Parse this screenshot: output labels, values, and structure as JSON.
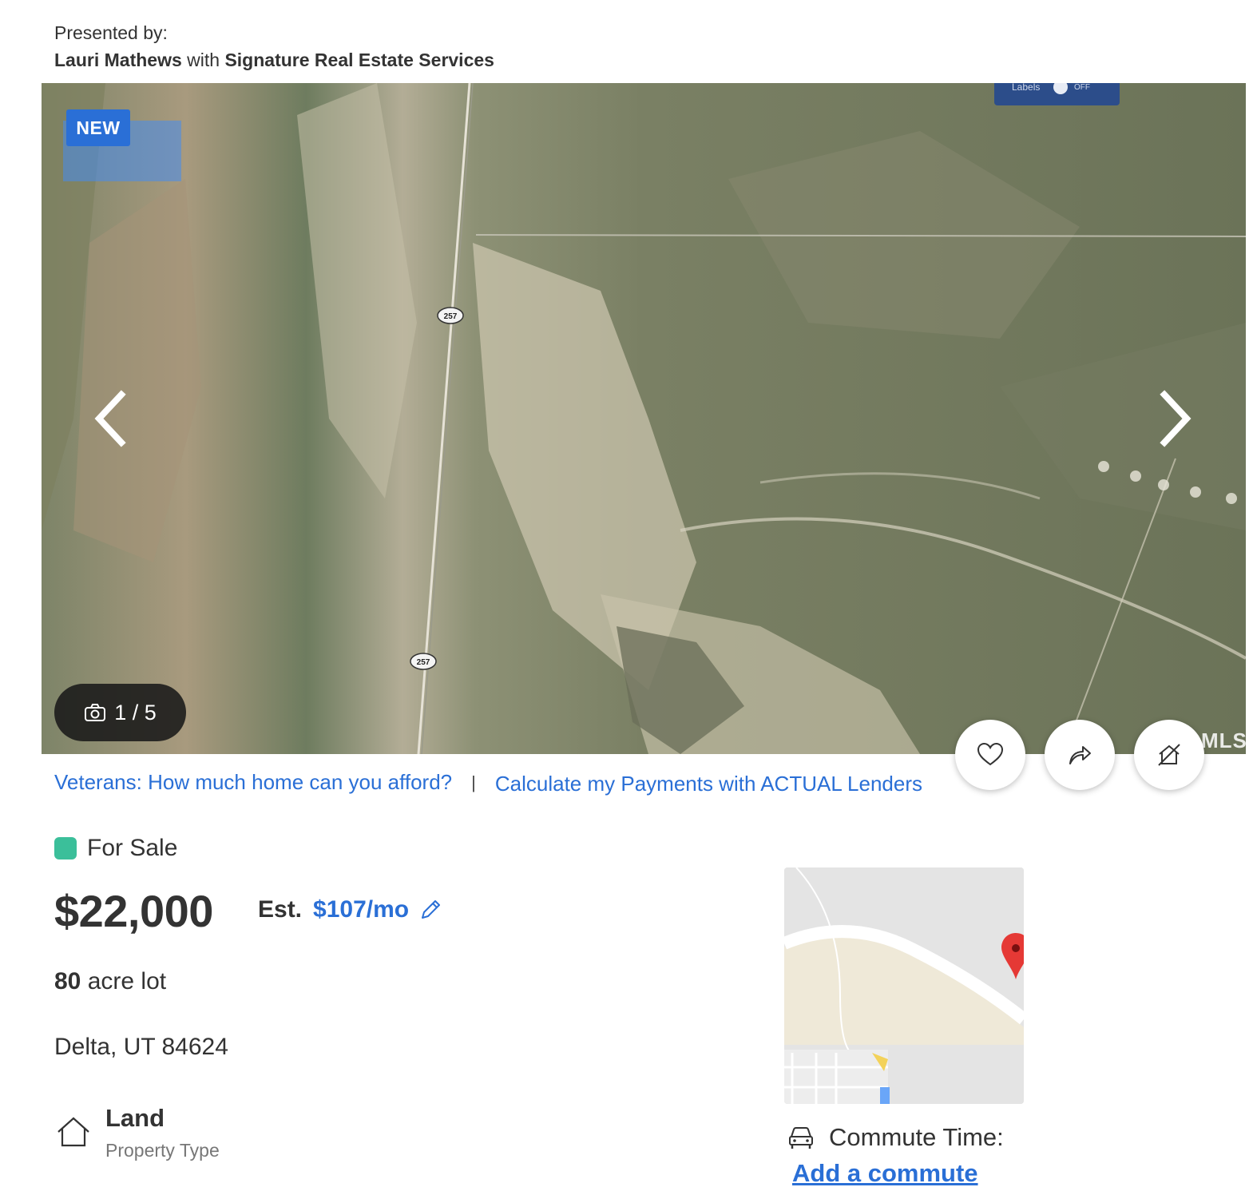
{
  "presented": {
    "label": "Presented by:",
    "agent": "Lauri Mathews",
    "with": "with",
    "brokerage": "Signature Real Estate Services"
  },
  "gallery": {
    "badge": "NEW",
    "map_toggle_label": "Labels",
    "map_toggle_state": "OFF",
    "road_shield_1": "257",
    "road_shield_2": "257",
    "photo_counter": "1 / 5",
    "watermark": "MLS",
    "icons": [
      "chevron-left-icon",
      "chevron-right-icon",
      "camera-icon",
      "heart-icon",
      "share-icon",
      "hide-icon"
    ]
  },
  "links": {
    "veterans": "Veterans: How much home can you afford?",
    "separator": "|",
    "payments": "Calculate my Payments with ACTUAL Lenders"
  },
  "listing": {
    "status": "For Sale",
    "status_color": "#3bbf9a",
    "price": "$22,000",
    "est_label": "Est.",
    "est_amount": "$107/mo",
    "lot_size": "80",
    "lot_unit": "acre lot",
    "address": "Delta, UT 84624",
    "property_type_value": "Land",
    "property_type_label": "Property Type"
  },
  "commute": {
    "label": "Commute Time:",
    "link": "Add a commute"
  },
  "colors": {
    "accent": "#2a6fd6",
    "text": "#333333",
    "muted": "#777777"
  }
}
